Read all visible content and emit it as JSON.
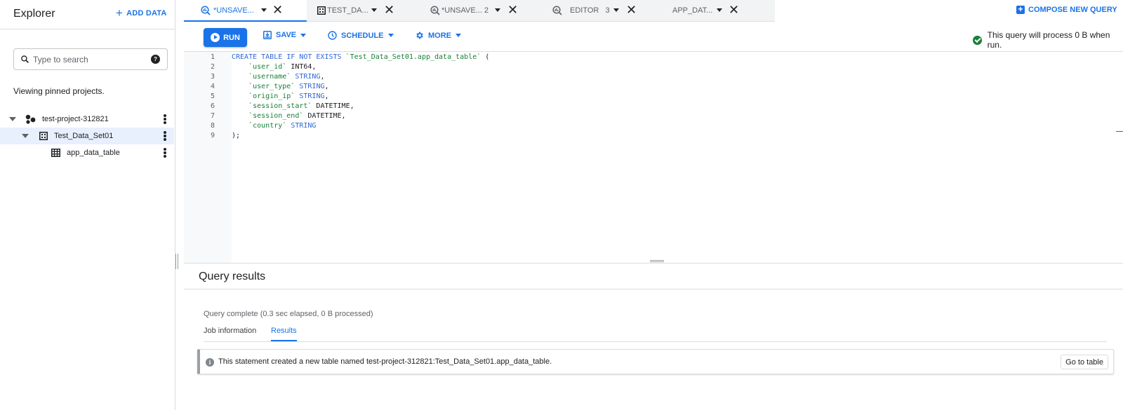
{
  "sidebar": {
    "title": "Explorer",
    "add_data_label": "ADD DATA",
    "search_placeholder": "Type to search",
    "pinned_note": "Viewing pinned projects.",
    "tree": [
      {
        "label": "test-project-312821"
      },
      {
        "label": "Test_Data_Set01"
      },
      {
        "label": "app_data_table"
      }
    ]
  },
  "tabs": [
    {
      "label": "*UNSAVE..."
    },
    {
      "label": "TEST_DA..."
    },
    {
      "label": "*UNSAVE... 2"
    },
    {
      "label": "EDITOR   3"
    },
    {
      "label": "APP_DAT..."
    }
  ],
  "compose_label": "COMPOSE NEW QUERY",
  "toolbar": {
    "run_label": "RUN",
    "save_label": "SAVE",
    "schedule_label": "SCHEDULE",
    "more_label": "MORE",
    "status_text": "This query will process 0 B when run."
  },
  "editor": {
    "line_numbers": [
      "1",
      "2",
      "3",
      "4",
      "5",
      "6",
      "7",
      "8",
      "9"
    ]
  },
  "results": {
    "title": "Query results",
    "status": "Query complete (0.3 sec elapsed, 0 B processed)",
    "tab_job": "Job information",
    "tab_results": "Results",
    "message": "This statement created a new table named test-project-312821:Test_Data_Set01.app_data_table.",
    "goto_label": "Go to table"
  },
  "colors": {
    "accent": "#1a73e8",
    "success": "#188038"
  },
  "icons": [
    "plus-icon",
    "search-icon",
    "help-icon",
    "project-icon",
    "dataset-icon",
    "table-icon",
    "query-icon",
    "close-icon",
    "play-icon",
    "save-icon",
    "clock-icon",
    "gear-icon",
    "check-circle-icon",
    "info-icon"
  ]
}
